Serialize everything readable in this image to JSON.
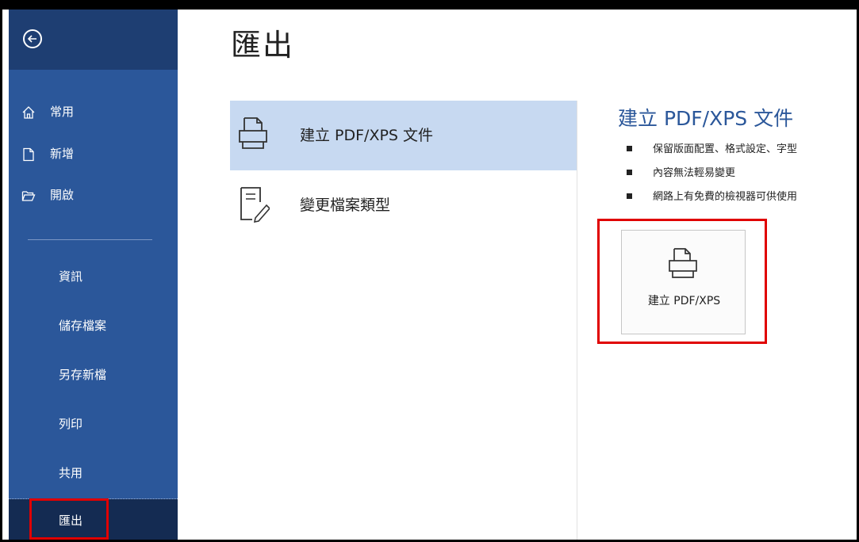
{
  "sidebar": {
    "back_icon": "back-arrow-icon",
    "items": [
      {
        "label": "常用",
        "icon": "home-icon"
      },
      {
        "label": "新增",
        "icon": "new-document-icon"
      },
      {
        "label": "開啟",
        "icon": "open-folder-icon"
      }
    ],
    "sub_items": [
      {
        "label": "資訊"
      },
      {
        "label": "儲存檔案"
      },
      {
        "label": "另存新檔"
      },
      {
        "label": "列印"
      },
      {
        "label": "共用"
      },
      {
        "label": "匯出",
        "active": true
      }
    ]
  },
  "main": {
    "title": "匯出",
    "options": [
      {
        "label": "建立 PDF/XPS 文件",
        "icon": "pdf-document-icon",
        "selected": true
      },
      {
        "label": "變更檔案類型",
        "icon": "change-file-type-icon",
        "selected": false
      }
    ],
    "detail": {
      "title": "建立 PDF/XPS 文件",
      "bullets": [
        "保留版面配置、格式設定、字型",
        "內容無法輕易變更",
        "網路上有免費的檢視器可供使用"
      ],
      "button_label": "建立 PDF/XPS",
      "button_icon": "pdf-document-icon"
    }
  },
  "colors": {
    "sidebar": "#2b579a",
    "sidebar_dark": "#1e3e72",
    "selected": "#c7d9f1",
    "highlight": "#e00000"
  }
}
